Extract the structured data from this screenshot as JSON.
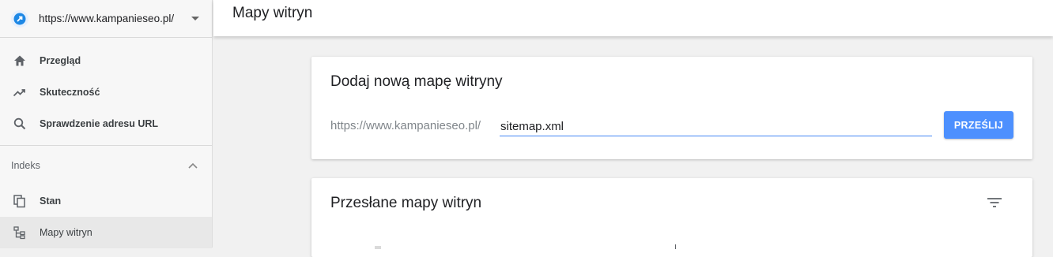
{
  "sidebar": {
    "property_url": "https://www.kampanieseo.pl/",
    "nav": [
      {
        "label": "Przegląd",
        "icon": "home-icon"
      },
      {
        "label": "Skuteczność",
        "icon": "trending-up-icon"
      },
      {
        "label": "Sprawdzenie adresu URL",
        "icon": "search-icon"
      }
    ],
    "index_section": {
      "label": "Indeks",
      "items": [
        {
          "label": "Stan",
          "icon": "copy-pages-icon"
        },
        {
          "label": "Mapy witryn",
          "icon": "sitemap-icon",
          "active": true
        }
      ]
    }
  },
  "header": {
    "title": "Mapy witryn"
  },
  "add_sitemap": {
    "title": "Dodaj nową mapę witryny",
    "prefix": "https://www.kampanieseo.pl/",
    "input_value": "sitemap.xml",
    "submit_label": "PRZEŚLIJ"
  },
  "submitted": {
    "title": "Przesłane mapy witryn",
    "filter_icon": "filter-icon"
  },
  "colors": {
    "accent": "#4d90fe",
    "input_underline": "#4285f4",
    "sidebar_bg": "#f7f7f7"
  }
}
